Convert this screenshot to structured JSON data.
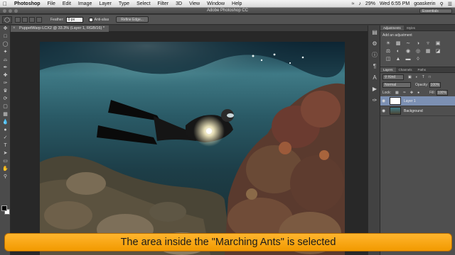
{
  "menubar": {
    "app_name": "Photoshop",
    "items": [
      "File",
      "Edit",
      "Image",
      "Layer",
      "Type",
      "Select",
      "Filter",
      "3D",
      "View",
      "Window",
      "Help"
    ],
    "battery": "29%",
    "clock": "Wed 6:55 PM",
    "user": "goaskerin"
  },
  "window": {
    "title": "Adobe Photoshop CC",
    "workspace": "Essentials"
  },
  "options": {
    "feather_label": "Feather:",
    "feather_value": "0 px",
    "antialias_label": "Anti-alias",
    "refine_edge_label": "Refine Edge..."
  },
  "document": {
    "tab_title": "PuppetWarp-LCX2 @ 33.3% (Layer 1, RGB/16) *"
  },
  "panels": {
    "top_tabs": [
      "Adjustments",
      "Styles"
    ],
    "adjust_title": "Add an adjustment",
    "layer_tabs": [
      "Layers",
      "Channels",
      "Paths"
    ],
    "kind_label": "Kind",
    "blend_mode": "Normal",
    "opacity_label": "Opacity:",
    "opacity_value": "100%",
    "lock_label": "Lock:",
    "fill_label": "Fill:",
    "fill_value": "100%",
    "layers": [
      {
        "name": "Layer 1",
        "active": true
      },
      {
        "name": "Background",
        "active": false
      }
    ]
  },
  "caption": "The area inside the \"Marching Ants\" is selected"
}
